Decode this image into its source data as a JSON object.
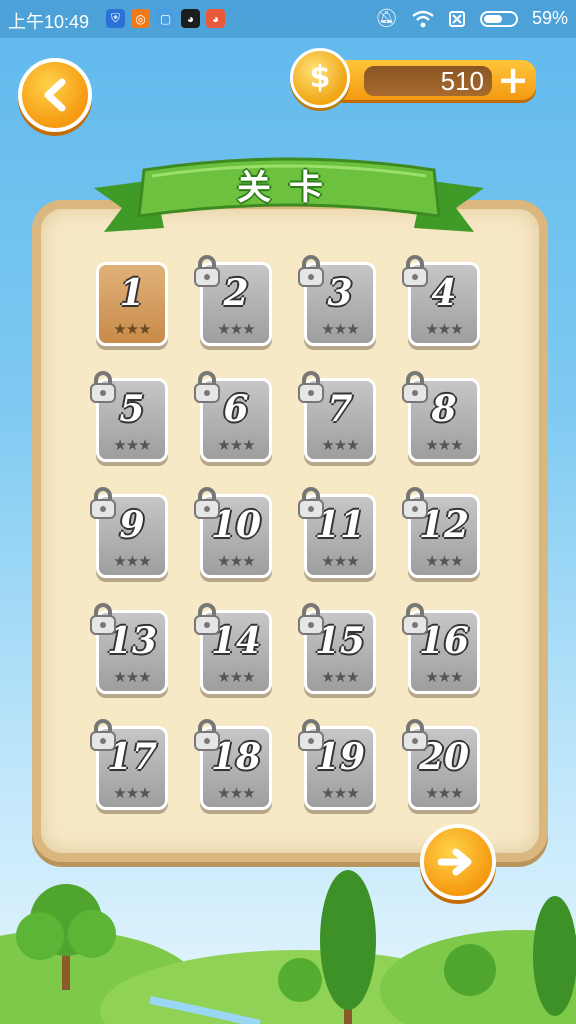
{
  "status_bar": {
    "time": "上午10:49",
    "battery": "59%",
    "battery_fraction": 0.59,
    "app_icons": [
      "shield-app-icon",
      "browser-app-icon",
      "square-app-icon",
      "qq-app-icon",
      "qq-app-icon-2"
    ]
  },
  "coins": {
    "value": "510"
  },
  "title": "关卡",
  "levels": [
    {
      "number": "1",
      "locked": false,
      "stars": "★★★"
    },
    {
      "number": "2",
      "locked": true,
      "stars": "★★★"
    },
    {
      "number": "3",
      "locked": true,
      "stars": "★★★"
    },
    {
      "number": "4",
      "locked": true,
      "stars": "★★★"
    },
    {
      "number": "5",
      "locked": true,
      "stars": "★★★"
    },
    {
      "number": "6",
      "locked": true,
      "stars": "★★★"
    },
    {
      "number": "7",
      "locked": true,
      "stars": "★★★"
    },
    {
      "number": "8",
      "locked": true,
      "stars": "★★★"
    },
    {
      "number": "9",
      "locked": true,
      "stars": "★★★"
    },
    {
      "number": "10",
      "locked": true,
      "stars": "★★★"
    },
    {
      "number": "11",
      "locked": true,
      "stars": "★★★"
    },
    {
      "number": "12",
      "locked": true,
      "stars": "★★★"
    },
    {
      "number": "13",
      "locked": true,
      "stars": "★★★"
    },
    {
      "number": "14",
      "locked": true,
      "stars": "★★★"
    },
    {
      "number": "15",
      "locked": true,
      "stars": "★★★"
    },
    {
      "number": "16",
      "locked": true,
      "stars": "★★★"
    },
    {
      "number": "17",
      "locked": true,
      "stars": "★★★"
    },
    {
      "number": "18",
      "locked": true,
      "stars": "★★★"
    },
    {
      "number": "19",
      "locked": true,
      "stars": "★★★"
    },
    {
      "number": "20",
      "locked": true,
      "stars": "★★★"
    }
  ],
  "colors": {
    "accent": "#f59a10",
    "banner": "#5fbf3a",
    "board": "#f7e8c6"
  }
}
